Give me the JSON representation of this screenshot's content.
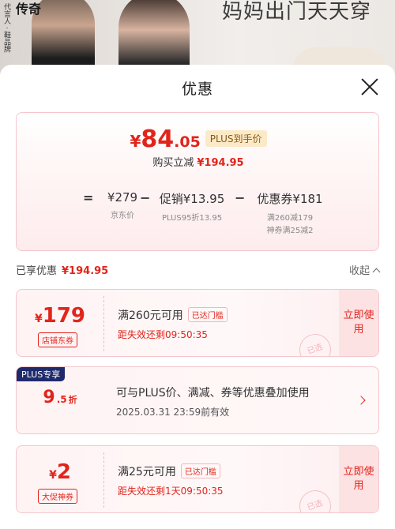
{
  "banner": {
    "brand": "传奇",
    "brand_vertical": "代言人 · 鞋品牌",
    "slogan": "妈妈出门天天穿"
  },
  "sheet": {
    "title": "优惠"
  },
  "summary": {
    "price_currency": "¥",
    "price_int": "84",
    "price_dec": ".05",
    "price_tag": "PLUS到手价",
    "save_label": "购买立减",
    "save_amount": "¥194.95",
    "formula": {
      "eq": "=",
      "jd_value": "¥279",
      "jd_label": "京东价",
      "minus1": "−",
      "promo_value": "促销¥13.95",
      "promo_label": "PLUS95折13.95",
      "minus2": "−",
      "coupon_value": "优惠券¥181",
      "coupon_label1": "满260减179",
      "coupon_label2": "神券满25减2"
    }
  },
  "enjoyed": {
    "label": "已享优惠",
    "amount": "¥194.95",
    "collapse": "收起"
  },
  "coupons": [
    {
      "currency": "¥",
      "value": "179",
      "kind": "店铺东券",
      "condition": "满260元可用",
      "reach": "已达门槛",
      "timer": "距失效还剩09:50:35",
      "use": "立即使用",
      "stamp": "已选"
    },
    {
      "currency": "¥",
      "value": "2",
      "kind": "大促神券",
      "condition": "满25元可用",
      "reach": "已达门槛",
      "timer": "距失效还剩1天09:50:35",
      "use": "立即使用",
      "stamp": "已选"
    }
  ],
  "plus_card": {
    "badge": "PLUS专享",
    "discount_int": "9",
    "discount_dec": ".5",
    "discount_unit": "折",
    "desc": "可与PLUS价、满减、券等优惠叠加使用",
    "date": "2025.03.31  23:59前有效"
  },
  "colors": {
    "accent": "#e1251b",
    "plus_badge": "#1e2a6b",
    "card_border": "#f5c6cc"
  }
}
